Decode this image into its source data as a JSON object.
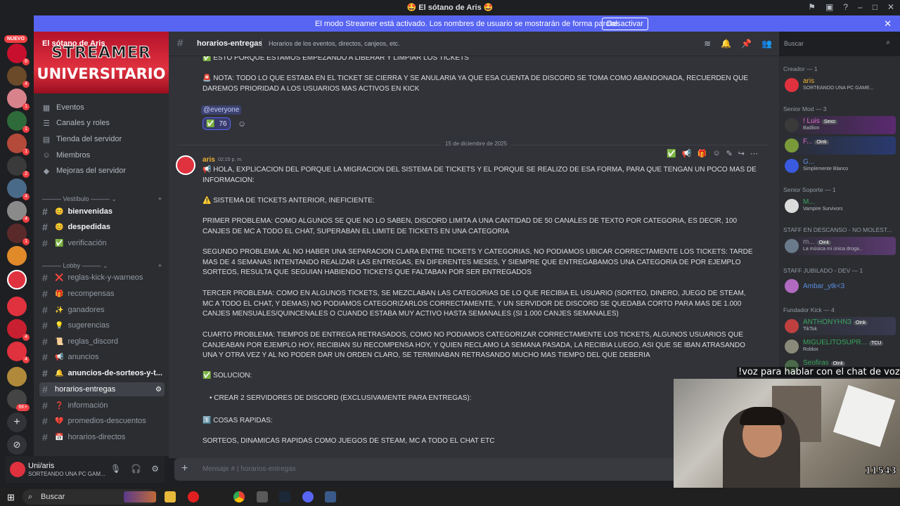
{
  "window": {
    "title": "🤩 El sótano de Aris 🤩"
  },
  "banner": {
    "message": "El modo Streamer está activado. Los nombres de usuario se mostrarán de forma parcial.",
    "button": "Desactivar"
  },
  "rail": {
    "new_label": "NUEVO",
    "badges": [
      "8",
      "4",
      "1",
      "1",
      "1",
      "2",
      "4",
      "4",
      "1",
      "4",
      "4",
      "6K+"
    ]
  },
  "server": {
    "name": "El sótano de Aris",
    "banner_line1": "STREAMER",
    "banner_line2": "UNIVERSITARIO",
    "menu": [
      "Eventos",
      "Canales y roles",
      "Tienda del servidor",
      "Miembros",
      "Mejoras del servidor"
    ]
  },
  "categories": {
    "vestibulo": "Vestíbulo",
    "lobby": "Lobby"
  },
  "channels": [
    {
      "name": "bienvenidas",
      "emoji": "😊"
    },
    {
      "name": "despedidas",
      "emoji": "😊"
    },
    {
      "name": "verificación",
      "emoji": "✅"
    },
    {
      "name": "reglas-kick-y-warneos",
      "emoji": "❌"
    },
    {
      "name": "recompensas",
      "emoji": "🎁"
    },
    {
      "name": "ganadores",
      "emoji": "✨"
    },
    {
      "name": "sugerencias",
      "emoji": "💡"
    },
    {
      "name": "reglas_discord",
      "emoji": "📜"
    },
    {
      "name": "anuncios",
      "emoji": "📢"
    },
    {
      "name": "anuncios-de-sorteos-y-t...",
      "emoji": "🔔"
    },
    {
      "name": "horarios-entregas",
      "emoji": ""
    },
    {
      "name": "información",
      "emoji": "❓"
    },
    {
      "name": "promedios-descuentos",
      "emoji": "💔"
    },
    {
      "name": "horarios-directos",
      "emoji": "📅"
    }
  ],
  "user": {
    "name": "Uni/aris",
    "status": "SORTEANDO UNA PC GAM..."
  },
  "channel_header": {
    "name": "horarios-entregas",
    "topic": "Horarios de los eventos, directos, canjeos, etc."
  },
  "search": {
    "placeholder": "Buscar"
  },
  "messages": {
    "prev_line1": "✅ ESTO PORQUE ESTAMOS EMPEZANDO A LIBERAR Y LIMPIAR LOS TICKETS",
    "prev_line2": "🚨 NOTA: TODO LO QUE ESTABA EN EL TICKET SE CIERRA Y SE ANULARIA YA QUE ESA CUENTA DE DISCORD SE TOMA COMO ABANDONADA, RECUERDEN QUE DAREMOS PRIORIDAD A LOS USUARIOS MAS ACTIVOS EN KICK",
    "mention": "@everyone",
    "reaction_count": "76",
    "date_divider": "15 de diciembre de 2025",
    "author": "aris",
    "time": "02:15 p. m.",
    "body": [
      "📢 HOLA, EXPLICACION DEL PORQUE LA MIGRACION DEL SISTEMA DE TICKETS Y EL PORQUE SE REALIZO DE ESA FORMA, PARA QUE TENGAN UN POCO MAS DE INFORMACION:",
      "⚠️ SISTEMA DE TICKETS ANTERIOR, INEFICIENTE:",
      "PRIMER PROBLEMA: COMO ALGUNOS SE QUE NO LO SABEN, DISCORD LIMITA A UNA CANTIDAD DE 50 CANALES DE TEXTO POR CATEGORIA, ES DECIR, 100 CANJES DE MC A TODO EL CHAT, SUPERABAN EL LIMITE DE TICKETS EN UNA CATEGORIA",
      "SEGUNDO PROBLEMA: AL NO HABER UNA SEPARACION CLARA ENTRE TICKETS Y CATEGORIAS, NO PODIAMOS UBICAR CORRECTAMENTE LOS TICKETS: TARDE MAS DE 4 SEMANAS INTENTANDO REALIZAR LAS ENTREGAS, EN DIFERENTES MESES, Y SIEMPRE QUE ENTREGABAMOS UNA CATEGORIA DE POR EJEMPLO SORTEOS, RESULTA QUE SEGUIAN HABIENDO TICKETS QUE FALTABAN POR SER ENTREGADOS",
      "TERCER PROBLEMA: COMO EN ALGUNOS TICKETS, SE MEZCLABAN LAS CATEGORIAS DE LO QUE RECIBIA EL USUARIO (SORTEO, DINERO, JUEGO DE STEAM, MC A TODO EL CHAT, Y DEMAS) NO PODIAMOS CATEGORIZARLOS CORRECTAMENTE, Y UN SERVIDOR DE DISCORD SE QUEDABA CORTO PARA MAS DE 1.000 CANJES MENSUALES/QUINCENALES O CUANDO ESTABA MUY ACTIVO HASTA SEMANALES (SI 1.000 CANJES SEMANALES)",
      "CUARTO PROBLEMA: TIEMPOS DE ENTREGA RETRASADOS, COMO NO PODIAMOS CATEGORIZAR CORRECTAMENTE LOS TICKETS, ALGUNOS USUARIOS QUE CANJEABAN POR EJEMPLO HOY, RECIBIAN SU RECOMPENSA HOY, Y QUIEN RECLAMO LA SEMANA PASADA, LA RECIBIA LUEGO, ASI QUE SE IBAN ATRASANDO UNA Y OTRA VEZ Y AL NO PODER DAR UN ORDEN CLARO, SE TERMINABAN RETRASANDO MUCHO MAS TIEMPO DEL QUE DEBERIA",
      "✅ SOLUCION:",
      "CREAR 2 SERVIDORES DE DISCORD (EXCLUSIVAMENTE PARA ENTREGAS):",
      "1️⃣ COSAS RAPIDAS:",
      "SORTEOS, DINAMICAS RAPIDAS COMO JUEGOS DE STEAM, MC A TODO EL CHAT ETC"
    ]
  },
  "composer": {
    "placeholder": "Mensaje # | horarios-entregas"
  },
  "members": {
    "roles": [
      "Creador — 1",
      "Senior Mod — 3",
      "Senior Soporte — 1",
      "STAFF EN DESCANSO - NO MOLEST...",
      "STAFF JUBILADO - DEV — 1",
      "Fundador Kick — 4"
    ],
    "list": [
      {
        "name": "aris",
        "sub": "SORTEANDO UNA PC GAME...",
        "color": "#f0b232",
        "tag": ""
      },
      {
        "name": "! Luis",
        "sub": "Badlion",
        "color": "#e06bd0",
        "tag": "Sexo"
      },
      {
        "name": "F...",
        "sub": "",
        "color": "#e06bd0",
        "tag": "Oink"
      },
      {
        "name": "G...",
        "sub": "Simplemente Blanco",
        "color": "#5c8de0",
        "tag": ""
      },
      {
        "name": "M...",
        "sub": "Vampire Survivors",
        "color": "#3ba55d",
        "tag": ""
      },
      {
        "name": "m...",
        "sub": "La música mi única droga...",
        "color": "#949ba4",
        "tag": "Oink"
      },
      {
        "name": "Ambar_ytk<3",
        "sub": "",
        "color": "#5c8de0",
        "tag": ""
      },
      {
        "name": "ANTHONYHN3",
        "sub": "TikTok",
        "color": "#3ba55d",
        "tag": "Oink"
      },
      {
        "name": "MIGUELITOSUPR...",
        "sub": "Roblox",
        "color": "#3ba55d",
        "tag": "TCU"
      },
      {
        "name": "Seofiras",
        "sub": "",
        "color": "#3ba55d",
        "tag": "Oink"
      }
    ]
  },
  "stream": {
    "voice_overlay": "!voz para hablar con el chat de voz",
    "count": "11543"
  },
  "taskbar": {
    "search": "Buscar"
  }
}
